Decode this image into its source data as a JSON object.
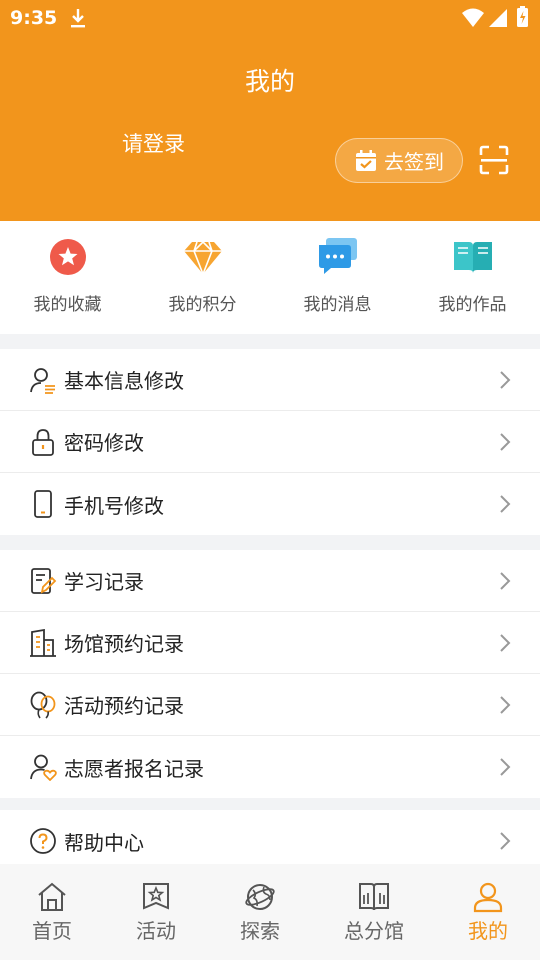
{
  "status_bar": {
    "time": "9:35"
  },
  "header": {
    "title": "我的",
    "login_prompt": "请登录",
    "checkin_label": "去签到"
  },
  "quick_actions": [
    {
      "label": "我的收藏",
      "icon": "star-badge-icon"
    },
    {
      "label": "我的积分",
      "icon": "diamond-icon"
    },
    {
      "label": "我的消息",
      "icon": "message-icon"
    },
    {
      "label": "我的作品",
      "icon": "book-icon"
    }
  ],
  "account_menu": [
    {
      "label": "基本信息修改",
      "icon": "user-edit-icon"
    },
    {
      "label": "密码修改",
      "icon": "lock-icon"
    },
    {
      "label": "手机号修改",
      "icon": "phone-icon"
    }
  ],
  "record_menu": [
    {
      "label": "学习记录",
      "icon": "notebook-pen-icon"
    },
    {
      "label": "场馆预约记录",
      "icon": "building-icon"
    },
    {
      "label": "活动预约记录",
      "icon": "balloon-icon"
    },
    {
      "label": "志愿者报名记录",
      "icon": "volunteer-heart-icon"
    }
  ],
  "help_menu": [
    {
      "label": "帮助中心",
      "icon": "help-circle-icon"
    }
  ],
  "tabbar": [
    {
      "label": "首页",
      "icon": "home-icon"
    },
    {
      "label": "活动",
      "icon": "activity-icon"
    },
    {
      "label": "探索",
      "icon": "globe-icon"
    },
    {
      "label": "总分馆",
      "icon": "library-icon"
    },
    {
      "label": "我的",
      "icon": "person-icon",
      "active": true
    }
  ],
  "colors": {
    "accent": "#f2951c",
    "page_bg": "#f2f3f5",
    "text": "#222222"
  }
}
